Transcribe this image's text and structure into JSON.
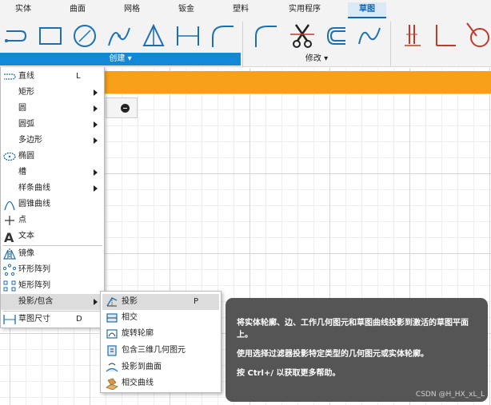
{
  "tabs": [
    "实体",
    "曲面",
    "网格",
    "钣金",
    "塑料",
    "实用程序",
    "草图"
  ],
  "active_tab": "草图",
  "groups": {
    "create_label": "创建 ▾",
    "modify_label": "修改 ▾"
  },
  "create_menu": {
    "items": [
      {
        "label": "直线",
        "shortcut": "L",
        "icon": "line-icon",
        "submenu": false
      },
      {
        "label": "矩形",
        "shortcut": "",
        "icon": "",
        "submenu": true
      },
      {
        "label": "圆",
        "shortcut": "",
        "icon": "",
        "submenu": true
      },
      {
        "label": "圆弧",
        "shortcut": "",
        "icon": "",
        "submenu": true
      },
      {
        "label": "多边形",
        "shortcut": "",
        "icon": "",
        "submenu": true
      },
      {
        "label": "椭圆",
        "shortcut": "",
        "icon": "ellipse-icon",
        "submenu": false
      },
      {
        "label": "槽",
        "shortcut": "",
        "icon": "",
        "submenu": true
      },
      {
        "label": "样条曲线",
        "shortcut": "",
        "icon": "",
        "submenu": true
      },
      {
        "label": "圆锥曲线",
        "shortcut": "",
        "icon": "conic-icon",
        "submenu": false
      },
      {
        "label": "点",
        "shortcut": "",
        "icon": "point-icon",
        "submenu": false
      },
      {
        "label": "文本",
        "shortcut": "",
        "icon": "text-icon",
        "submenu": false
      },
      {
        "label": "镜像",
        "shortcut": "",
        "icon": "mirror-icon",
        "submenu": false
      },
      {
        "label": "环形阵列",
        "shortcut": "",
        "icon": "circular-pattern-icon",
        "submenu": false
      },
      {
        "label": "矩形阵列",
        "shortcut": "",
        "icon": "rectangular-pattern-icon",
        "submenu": false
      },
      {
        "label": "投影/包含",
        "shortcut": "",
        "icon": "",
        "submenu": true
      },
      {
        "label": "草图尺寸",
        "shortcut": "D",
        "icon": "dimension-icon",
        "submenu": false
      }
    ]
  },
  "submenu": {
    "items": [
      {
        "label": "投影",
        "shortcut": "P",
        "icon": "project-icon"
      },
      {
        "label": "相交",
        "shortcut": "",
        "icon": "intersect-icon"
      },
      {
        "label": "旋转轮廓",
        "shortcut": "",
        "icon": "revolve-profile-icon"
      },
      {
        "label": "包含三维几何图元",
        "shortcut": "",
        "icon": "include-3d-icon"
      },
      {
        "label": "投影到曲面",
        "shortcut": "",
        "icon": "project-to-surface-icon"
      },
      {
        "label": "相交曲线",
        "shortcut": "",
        "icon": "intersection-curve-icon"
      }
    ]
  },
  "tooltip": {
    "line1": "将实体轮廓、边、工作几何图元和草图曲线投影到激活的草图平面上。",
    "line2": "使用选择过滤器投影特定类型的几何图元或实体轮廓。",
    "line3": "按 Ctrl+/ 以获取更多帮助。"
  },
  "watermark": "CSDN @H_HX_xL_L",
  "colors": {
    "accent_blue": "#1388d6",
    "orange_bar": "#f8a01a",
    "tooltip_bg": "#555555",
    "tool_icon_blue": "#1a6fb5",
    "tool_icon_red": "#c0392b"
  }
}
